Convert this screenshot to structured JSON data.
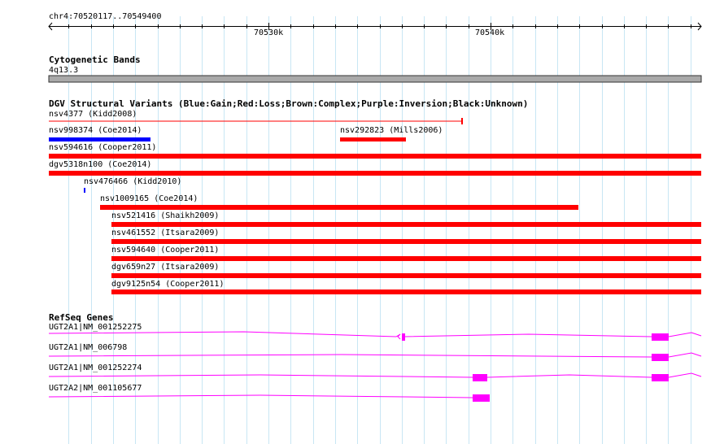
{
  "ruler": {
    "region": "chr4:70520117..70549400",
    "ticks": [
      "70530k",
      "70540k"
    ]
  },
  "tracks": {
    "cytoband": {
      "title": "Cytogenetic Bands",
      "band": "4q13.3"
    },
    "dgv": {
      "title": "DGV Structural Variants (Blue:Gain;Red:Loss;Brown:Complex;Purple:Inversion;Black:Unknown)",
      "features": [
        {
          "label": "nsv4377 (Kidd2008)",
          "type": "line",
          "color": "#ff0000"
        },
        {
          "label": "nsv998374 (Coe2014)",
          "type": "bar",
          "color": "#0000ff"
        },
        {
          "label": "nsv292823 (Mills2006)",
          "type": "bar",
          "color": "#ff0000"
        },
        {
          "label": "nsv594616 (Cooper2011)",
          "type": "bar",
          "color": "#ff0000"
        },
        {
          "label": "dgv5318n100 (Coe2014)",
          "type": "bar",
          "color": "#ff0000"
        },
        {
          "label": "nsv476466 (Kidd2010)",
          "type": "tick",
          "color": "#0000ff"
        },
        {
          "label": "nsv1009165 (Coe2014)",
          "type": "bar",
          "color": "#ff0000"
        },
        {
          "label": "nsv521416 (Shaikh2009)",
          "type": "bar",
          "color": "#ff0000"
        },
        {
          "label": "nsv461552 (Itsara2009)",
          "type": "bar",
          "color": "#ff0000"
        },
        {
          "label": "nsv594640 (Cooper2011)",
          "type": "bar",
          "color": "#ff0000"
        },
        {
          "label": "dgv659n27 (Itsara2009)",
          "type": "bar",
          "color": "#ff0000"
        },
        {
          "label": "dgv9125n54 (Cooper2011)",
          "type": "bar",
          "color": "#ff0000"
        }
      ]
    },
    "refseq": {
      "title": "RefSeq Genes",
      "color": "#ff00ff",
      "genes": [
        {
          "label": "UGT2A1|NM_001252275"
        },
        {
          "label": "UGT2A1|NM_006798"
        },
        {
          "label": "UGT2A1|NM_001252274"
        },
        {
          "label": "UGT2A2|NM_001105677"
        }
      ]
    }
  },
  "colors": {
    "grid": "#c8e6f4",
    "ruler": "#000000",
    "cytoband": "#a9a9a9",
    "loss": "#ff0000",
    "gain": "#0000ff",
    "gene": "#ff00ff"
  }
}
